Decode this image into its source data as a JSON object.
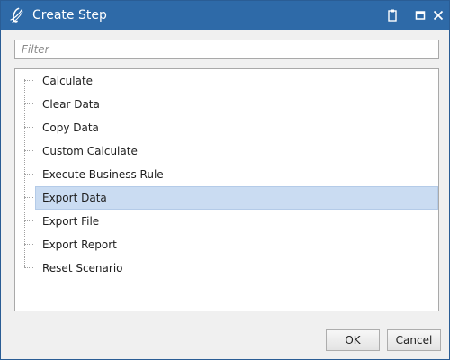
{
  "window": {
    "title": "Create Step",
    "accent_color": "#2e6aa8",
    "controls": [
      "clipboard-icon",
      "maximize-icon",
      "close-icon"
    ]
  },
  "filter": {
    "placeholder": "Filter",
    "value": ""
  },
  "tree": {
    "items": [
      {
        "label": "Calculate",
        "selected": false
      },
      {
        "label": "Clear Data",
        "selected": false
      },
      {
        "label": "Copy Data",
        "selected": false
      },
      {
        "label": "Custom Calculate",
        "selected": false
      },
      {
        "label": "Execute Business Rule",
        "selected": false
      },
      {
        "label": "Export Data",
        "selected": true
      },
      {
        "label": "Export File",
        "selected": false
      },
      {
        "label": "Export Report",
        "selected": false
      },
      {
        "label": "Reset Scenario",
        "selected": false
      }
    ],
    "selection_color": "#cadcf2"
  },
  "footer": {
    "ok_label": "OK",
    "cancel_label": "Cancel"
  }
}
